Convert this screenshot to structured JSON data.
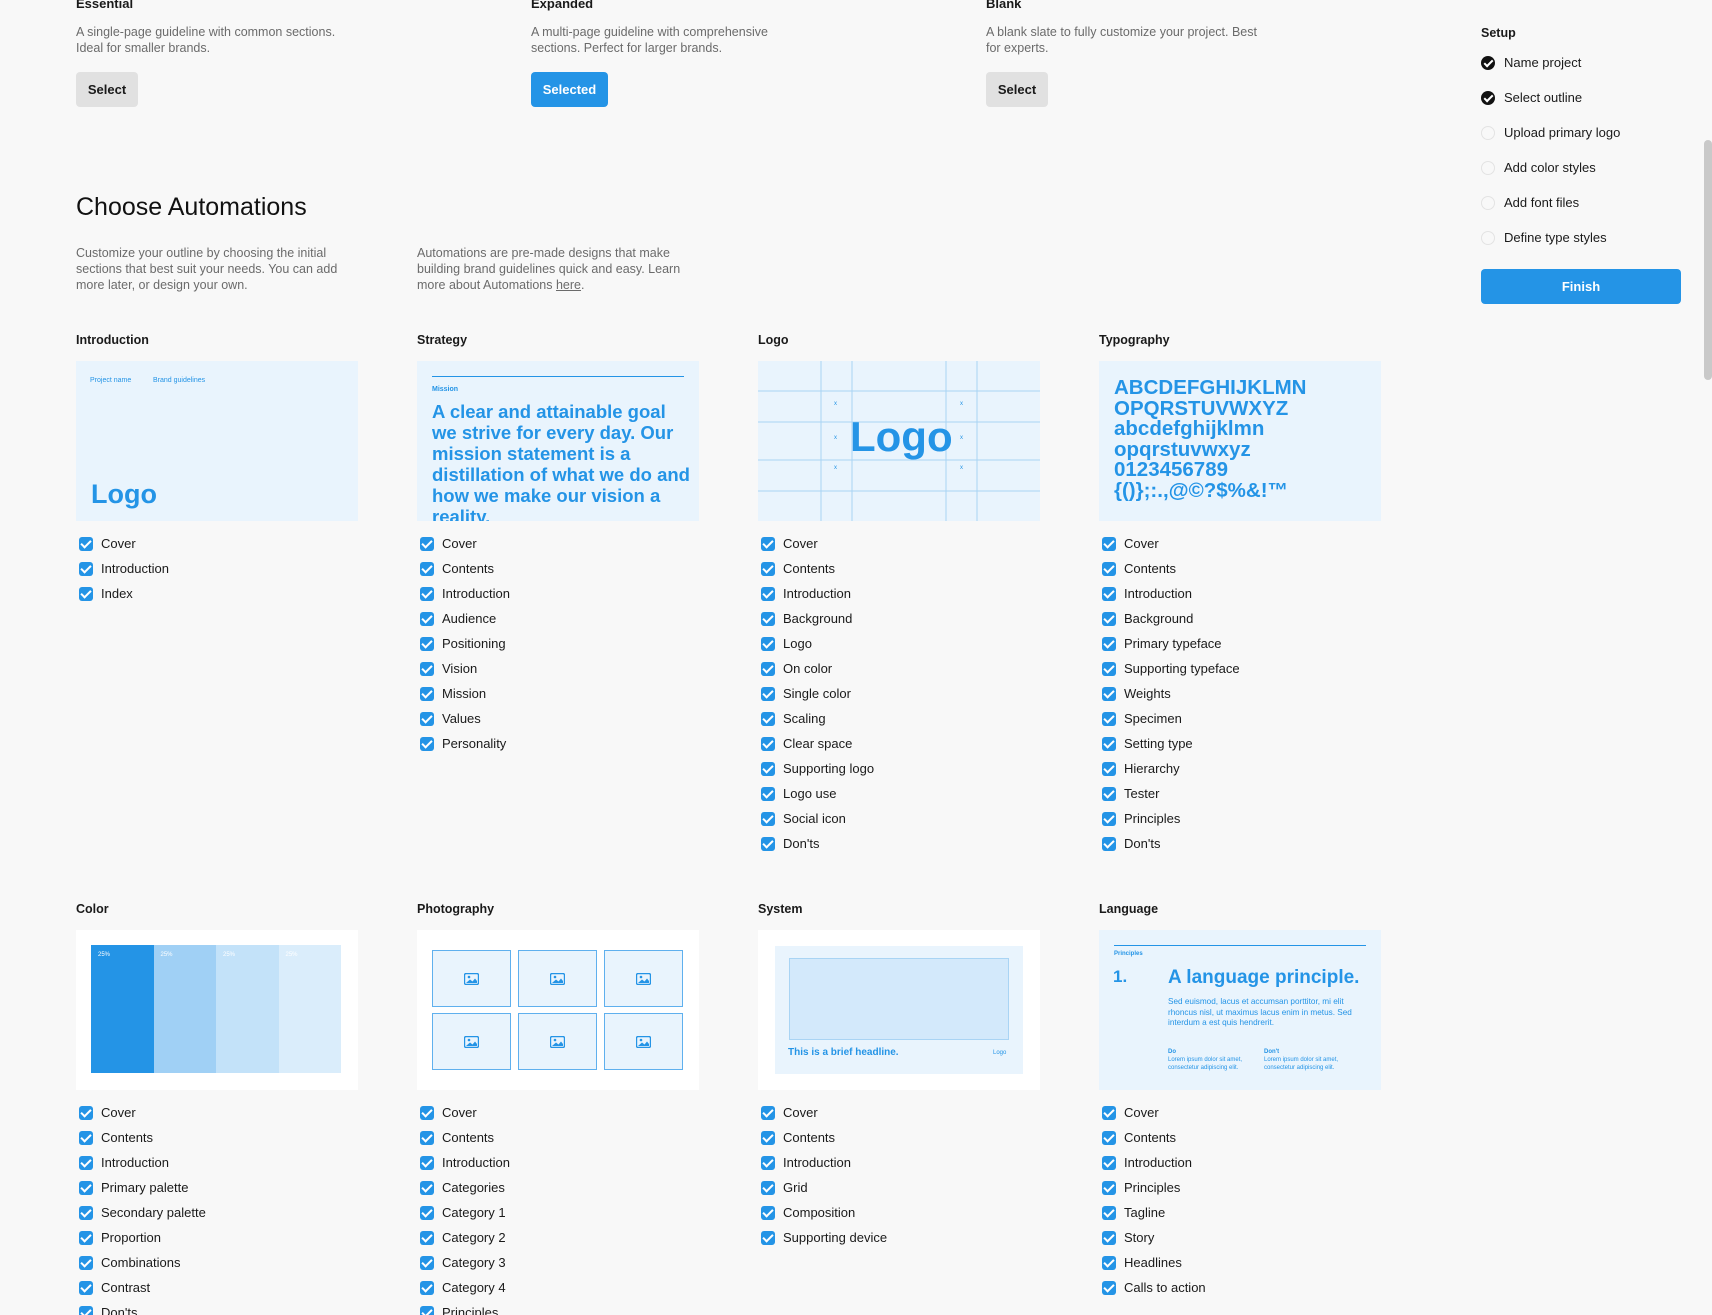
{
  "templates": [
    {
      "title": "Essential",
      "desc": "A single-page guideline with common sections. Ideal for smaller brands.",
      "button": "Select",
      "selected": false
    },
    {
      "title": "Expanded",
      "desc": "A multi-page guideline with comprehensive sections. Perfect for larger brands.",
      "button": "Selected",
      "selected": true
    },
    {
      "title": "Blank",
      "desc": "A blank slate to fully customize your project. Best for experts.",
      "button": "Select",
      "selected": false
    }
  ],
  "heading": "Choose Automations",
  "intro_left": "Customize your outline by choosing the initial sections that best suit your needs. You can add more later, or design your own.",
  "intro_right": "Automations are pre-made designs that make building brand guidelines quick and easy. Learn more about Automations",
  "intro_link": "here",
  "intro_period": ".",
  "setup": {
    "title": "Setup",
    "steps": [
      {
        "label": "Name project",
        "done": true
      },
      {
        "label": "Select outline",
        "done": true
      },
      {
        "label": "Upload primary logo",
        "done": false
      },
      {
        "label": "Add color styles",
        "done": false
      },
      {
        "label": "Add font files",
        "done": false
      },
      {
        "label": "Define type styles",
        "done": false
      }
    ],
    "finish": "Finish"
  },
  "previews": {
    "intro": {
      "project": "Project name",
      "brand": "Brand guidelines",
      "logo": "Logo"
    },
    "strategy": {
      "label": "Mission",
      "text": "A clear and attainable goal we strive for every day. Our mission statement is a distillation of what we do and how we make our vision a reality."
    },
    "logo": {
      "logo": "Logo",
      "mark": "x"
    },
    "typography": {
      "lines": [
        "ABCDEFGHIJKLMN",
        "OPQRSTUVWXYZ",
        "abcdefghijklmn",
        "opqrstuvwxyz",
        "0123456789",
        "{()};:.,@©?$%&!™"
      ]
    },
    "color": {
      "swatches": [
        {
          "label": "25%",
          "color": "#2494e6"
        },
        {
          "label": "25%",
          "color": "#a0d0f5"
        },
        {
          "label": "25%",
          "color": "#c3e2f9"
        },
        {
          "label": "25%",
          "color": "#daedfb"
        }
      ]
    },
    "system": {
      "headline": "This is a brief headline.",
      "logo": "Logo"
    },
    "language": {
      "label": "Principles",
      "num": "1.",
      "title": "A language principle.",
      "body": "Sed euismod, lacus et accumsan porttitor, mi elit rhoncus nisl, ut maximus lacus enim in metus. Sed interdum a est quis hendrerit.",
      "do": "Do",
      "dont": "Don't",
      "do_text": "Lorem ipsum dolor sit amet, consectetur adipiscing elit.",
      "dont_text": "Lorem ipsum dolor sit amet, consectetur adipiscing elit."
    }
  },
  "sections": [
    {
      "title": "Introduction",
      "items": [
        "Cover",
        "Introduction",
        "Index"
      ]
    },
    {
      "title": "Strategy",
      "items": [
        "Cover",
        "Contents",
        "Introduction",
        "Audience",
        "Positioning",
        "Vision",
        "Mission",
        "Values",
        "Personality"
      ]
    },
    {
      "title": "Logo",
      "items": [
        "Cover",
        "Contents",
        "Introduction",
        "Background",
        "Logo",
        "On color",
        "Single color",
        "Scaling",
        "Clear space",
        "Supporting logo",
        "Logo use",
        "Social icon",
        "Don'ts"
      ]
    },
    {
      "title": "Typography",
      "items": [
        "Cover",
        "Contents",
        "Introduction",
        "Background",
        "Primary typeface",
        "Supporting typeface",
        "Weights",
        "Specimen",
        "Setting type",
        "Hierarchy",
        "Tester",
        "Principles",
        "Don'ts"
      ]
    },
    {
      "title": "Color",
      "items": [
        "Cover",
        "Contents",
        "Introduction",
        "Primary palette",
        "Secondary palette",
        "Proportion",
        "Combinations",
        "Contrast",
        "Don'ts"
      ]
    },
    {
      "title": "Photography",
      "items": [
        "Cover",
        "Contents",
        "Introduction",
        "Categories",
        "Category 1",
        "Category 2",
        "Category 3",
        "Category 4",
        "Principles"
      ]
    },
    {
      "title": "System",
      "items": [
        "Cover",
        "Contents",
        "Introduction",
        "Grid",
        "Composition",
        "Supporting device"
      ]
    },
    {
      "title": "Language",
      "items": [
        "Cover",
        "Contents",
        "Introduction",
        "Principles",
        "Tagline",
        "Story",
        "Headlines",
        "Calls to action"
      ]
    }
  ]
}
